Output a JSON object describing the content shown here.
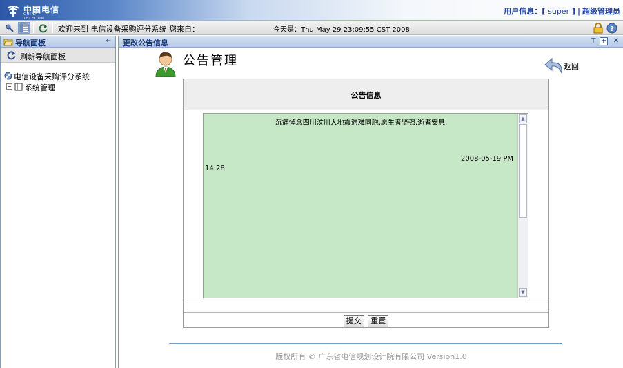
{
  "header": {
    "logo_text": "中国电信",
    "logo_sub": "CHINA TELECOM",
    "user_info_label": "用户信息：",
    "user_name": "super",
    "user_role": "超级管理员"
  },
  "toolbar": {
    "welcome": "欢迎来到 电信设备采购评分系统  您来自：",
    "today": "今天是：Thu May 29 23:09:55 CST 2008"
  },
  "left_panel": {
    "title": "导航面板",
    "refresh_label": "刷新导航面板",
    "tree_root": "电信设备采购评分系统",
    "tree_child": "系统管理",
    "tree_expander": "−"
  },
  "main_panel": {
    "title": "更改公告信息",
    "page_title": "公告管理",
    "back_label": "返回",
    "form_header": "公告信息",
    "announcement_text": "沉痛悼念四川汶川大地震遇难同胞,愿生者坚强,逝者安息.",
    "announcement_date": "2008-05-19 PM",
    "announcement_time": "14:28",
    "submit_label": "提交",
    "reset_label": "重置",
    "footer": "版权所有 © 广东省电信规划设计院有限公司  Version1.0"
  },
  "colors": {
    "header_blue": "#2c58a8",
    "panel_title_text": "#16387a",
    "content_green": "#c6e8c6"
  }
}
